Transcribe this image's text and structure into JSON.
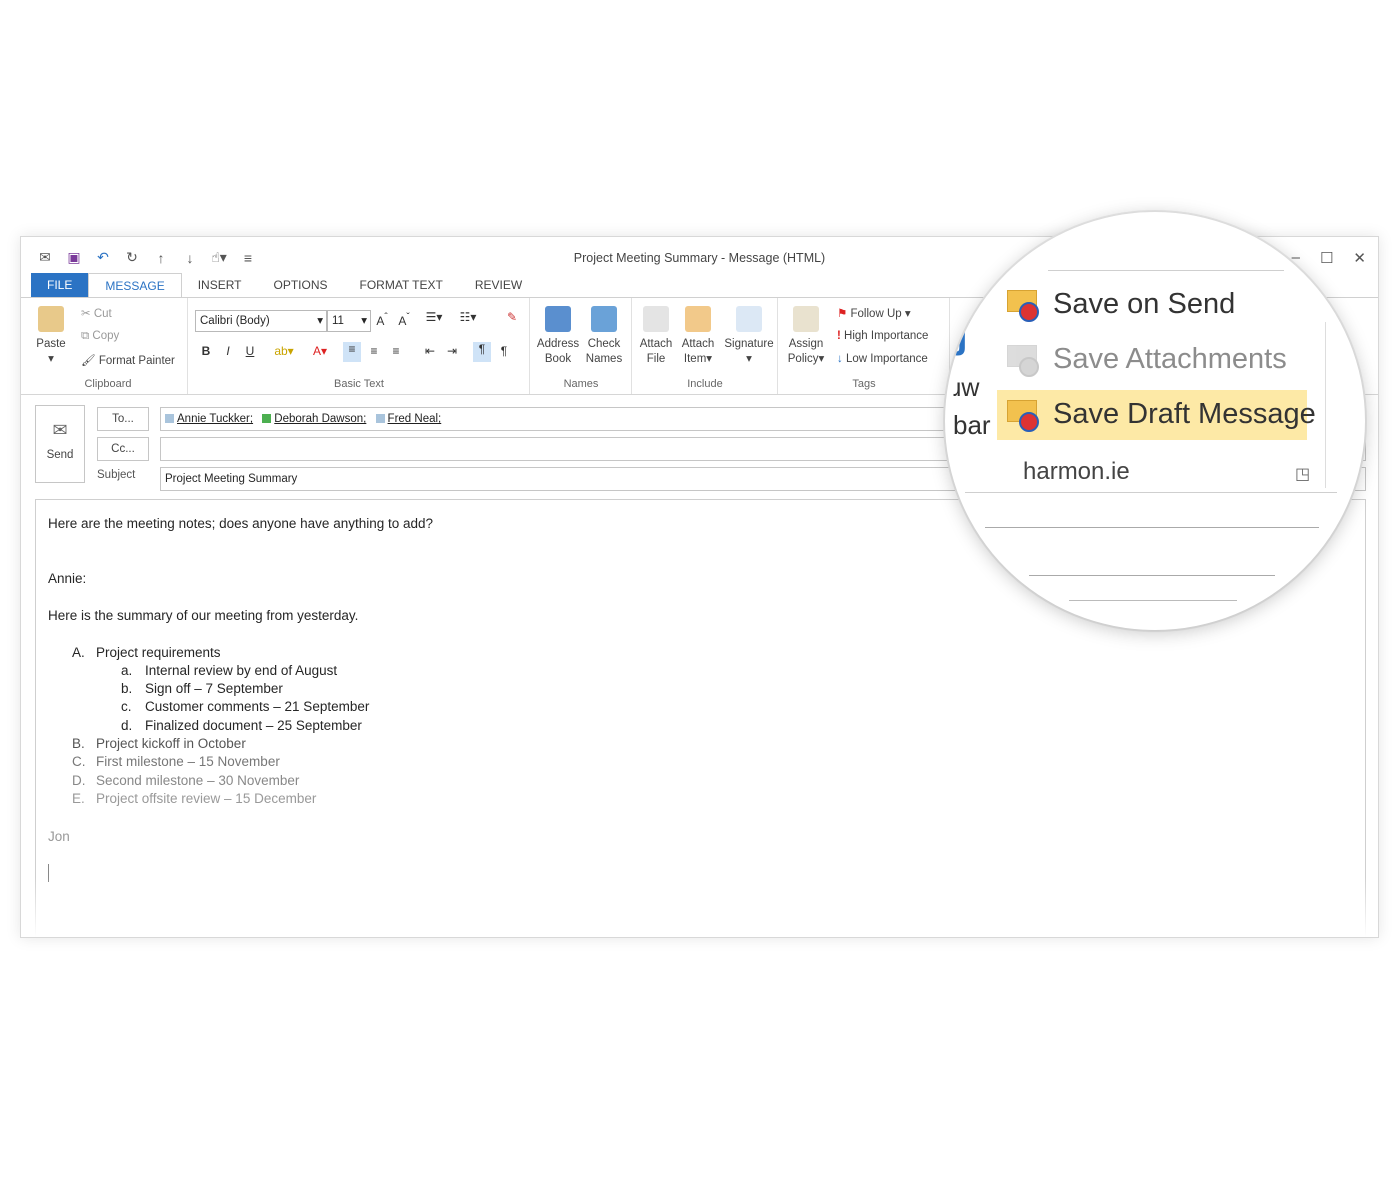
{
  "window": {
    "title": "Project Meeting Summary - Message (HTML)"
  },
  "tabs": [
    "FILE",
    "MESSAGE",
    "INSERT",
    "OPTIONS",
    "FORMAT TEXT",
    "REVIEW"
  ],
  "ribbon": {
    "clipboard": {
      "paste": "Paste",
      "cut": "Cut",
      "copy": "Copy",
      "format_painter": "Format Painter",
      "label": "Clipboard"
    },
    "basic_text": {
      "font": "Calibri (Body)",
      "size": "11",
      "label": "Basic Text"
    },
    "names": {
      "address_book": [
        "Address",
        "Book"
      ],
      "check_names": [
        "Check",
        "Names"
      ],
      "label": "Names"
    },
    "include": {
      "attach_file": [
        "Attach",
        "File"
      ],
      "attach_item": [
        "Attach",
        "Item"
      ],
      "signature": "Signature",
      "label": "Include"
    },
    "tags": {
      "assign_policy": [
        "Assign",
        "Policy"
      ],
      "follow_up": "Follow Up",
      "high": "High Importance",
      "low": "Low Importance",
      "label": "Tags"
    }
  },
  "compose": {
    "send": "Send",
    "to_button": "To...",
    "cc_button": "Cc...",
    "subject_label": "Subject",
    "recipients": [
      "Annie Tuckker;",
      "Deborah Dawson;",
      "Fred Neal;"
    ],
    "recipient_colors": [
      "#a9c4dc",
      "#4caf50",
      "#a9c4dc"
    ],
    "subject": "Project Meeting Summary"
  },
  "body": {
    "intro": "Here are the meeting notes; does anyone have anything to add?",
    "greeting": "Annie:",
    "summary": "Here is the summary of our meeting from yesterday.",
    "items": [
      {
        "m": "A.",
        "t": "Project requirements"
      },
      {
        "m": "a.",
        "t": "Internal review by end of August"
      },
      {
        "m": "b.",
        "t": "Sign off – 7 September"
      },
      {
        "m": "c.",
        "t": "Customer comments – 21 September"
      },
      {
        "m": "d.",
        "t": "Finalized document – 25 September"
      },
      {
        "m": "B.",
        "t": "Project kickoff in October"
      },
      {
        "m": "C.",
        "t": "First milestone – 15 November"
      },
      {
        "m": "D.",
        "t": "Second milestone – 30 November"
      },
      {
        "m": "E.",
        "t": "Project offsite review – 15 December"
      }
    ],
    "signature": "Jon"
  },
  "magnifier": {
    "save_on_send": "Save on Send",
    "save_attachments": "Save Attachments",
    "save_draft": "Save Draft Message",
    "group_label": "harmon.ie",
    "partial_left_1": "ɹw",
    "partial_left_2": "bar"
  }
}
